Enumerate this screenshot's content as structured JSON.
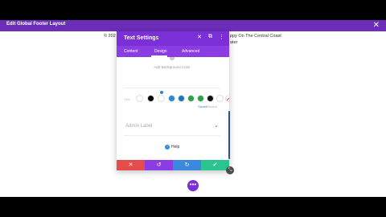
{
  "topbar": {
    "title": "Edit Global Footer Layout",
    "close": "✕"
  },
  "footer": {
    "left": "© 202",
    "right": "ppy On The Central Coast",
    "right2": "ater"
  },
  "panel": {
    "title": "Text Settings",
    "header_icons": {
      "close": "✕",
      "expand": "⧉",
      "more": "⋮"
    },
    "tabs": [
      "Content",
      "Design",
      "Advanced"
    ],
    "bg_label": "Add Background Color",
    "hex_placeholder": "Hex",
    "saved_label": "Saved",
    "recent_label": "Recent",
    "admin_label": "Admin Label",
    "help_label": "Help",
    "swatches": [
      "#ffffff",
      "#000000",
      "#ffffff",
      "#2b87da",
      "#1e73be",
      "#2f9e44",
      "#2f9e44",
      "#111111",
      "#ffffff",
      "strike"
    ]
  },
  "actions": {
    "cancel": "✕",
    "undo": "↺",
    "redo": "↻",
    "save": "✔"
  },
  "fab": "•••",
  "resize": "⤡"
}
